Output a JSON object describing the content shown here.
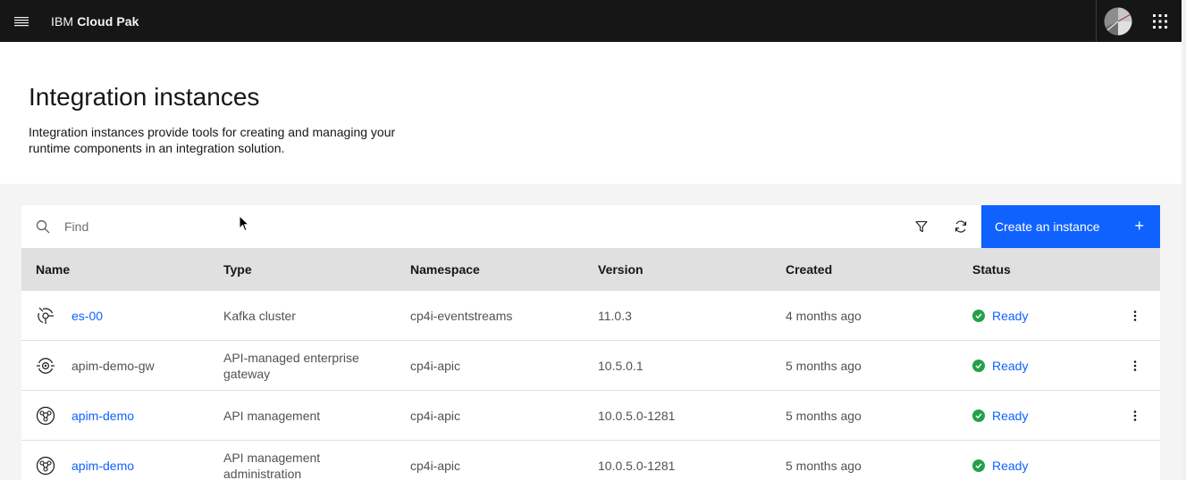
{
  "topbar": {
    "brand_prefix": "IBM",
    "brand_product": "Cloud Pak",
    "icons": [
      "hamburger-icon",
      "user-avatar-icon",
      "app-switcher-icon"
    ]
  },
  "header": {
    "title": "Integration instances",
    "description": "Integration instances provide tools for creating and managing your runtime components in an integration solution."
  },
  "toolbar": {
    "search_placeholder": "Find",
    "create_label": "Create an instance",
    "create_plus": "+"
  },
  "table": {
    "columns": [
      "Name",
      "Type",
      "Namespace",
      "Version",
      "Created",
      "Status"
    ],
    "rows": [
      {
        "name": "es-00",
        "name_is_link": true,
        "icon": "event-streams-icon",
        "type": "Kafka cluster",
        "namespace": "cp4i-eventstreams",
        "version": "11.0.3",
        "created": "4 months ago",
        "status": "Ready",
        "has_menu": true
      },
      {
        "name": "apim-demo-gw",
        "name_is_link": false,
        "icon": "gateway-icon",
        "type": "API-managed enterprise gateway",
        "namespace": "cp4i-apic",
        "version": "10.5.0.1",
        "created": "5 months ago",
        "status": "Ready",
        "has_menu": true
      },
      {
        "name": "apim-demo",
        "name_is_link": true,
        "icon": "api-management-icon",
        "type": "API management",
        "namespace": "cp4i-apic",
        "version": "10.0.5.0-1281",
        "created": "5 months ago",
        "status": "Ready",
        "has_menu": true
      },
      {
        "name": "apim-demo",
        "name_is_link": true,
        "icon": "api-management-icon",
        "type": "API management administration",
        "namespace": "cp4i-apic",
        "version": "10.0.5.0-1281",
        "created": "5 months ago",
        "status": "Ready",
        "has_menu": false
      }
    ]
  },
  "colors": {
    "topbar_bg": "#161616",
    "primary": "#0f62fe",
    "success": "#24a148",
    "table_header_bg": "#e0e0e0",
    "page_bg": "#f4f4f4"
  }
}
